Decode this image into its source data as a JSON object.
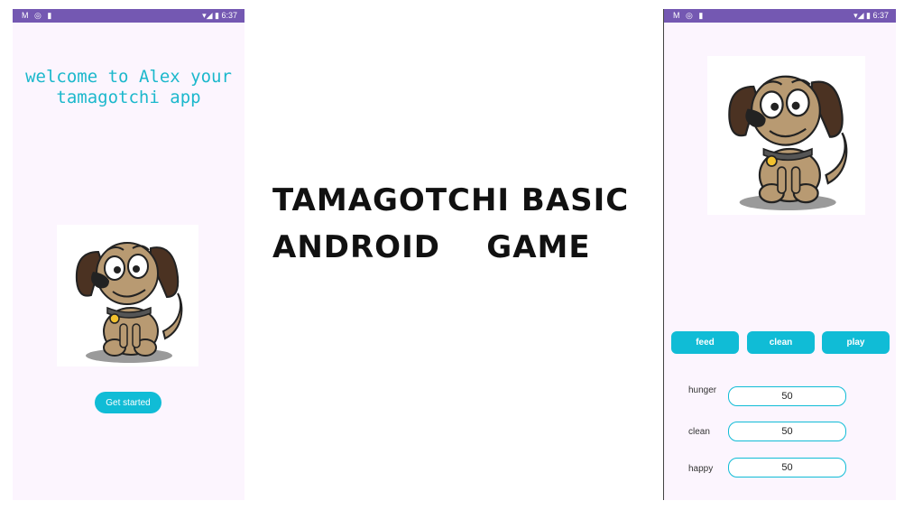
{
  "title_lines": [
    "TAMAGOTCHI BASIC",
    "ANDROID    GAME"
  ],
  "left_screen": {
    "status": {
      "left": "M ◎ ▮",
      "right": "▾◢ ▮ 6:37"
    },
    "welcome_line1": "welcome to Alex your",
    "welcome_line2": "tamagotchi app",
    "get_started_label": "Get started"
  },
  "right_screen": {
    "status": {
      "left": "M ◎ ▮",
      "right": "▾◢ ▮ 6:37"
    },
    "buttons": {
      "feed": "feed",
      "clean": "clean",
      "play": "play"
    },
    "stats": [
      {
        "label": "hunger",
        "value": "50"
      },
      {
        "label": "clean",
        "value": "50"
      },
      {
        "label": "happy",
        "value": "50"
      }
    ]
  },
  "colors": {
    "accent": "#10bcd6",
    "status_bar": "#7458b2",
    "screen_bg": "#fcf5fe"
  },
  "icons": [
    "gmail-icon",
    "sync-icon",
    "sd-card-icon",
    "wifi-icon",
    "signal-icon",
    "battery-icon",
    "dog-illustration"
  ]
}
